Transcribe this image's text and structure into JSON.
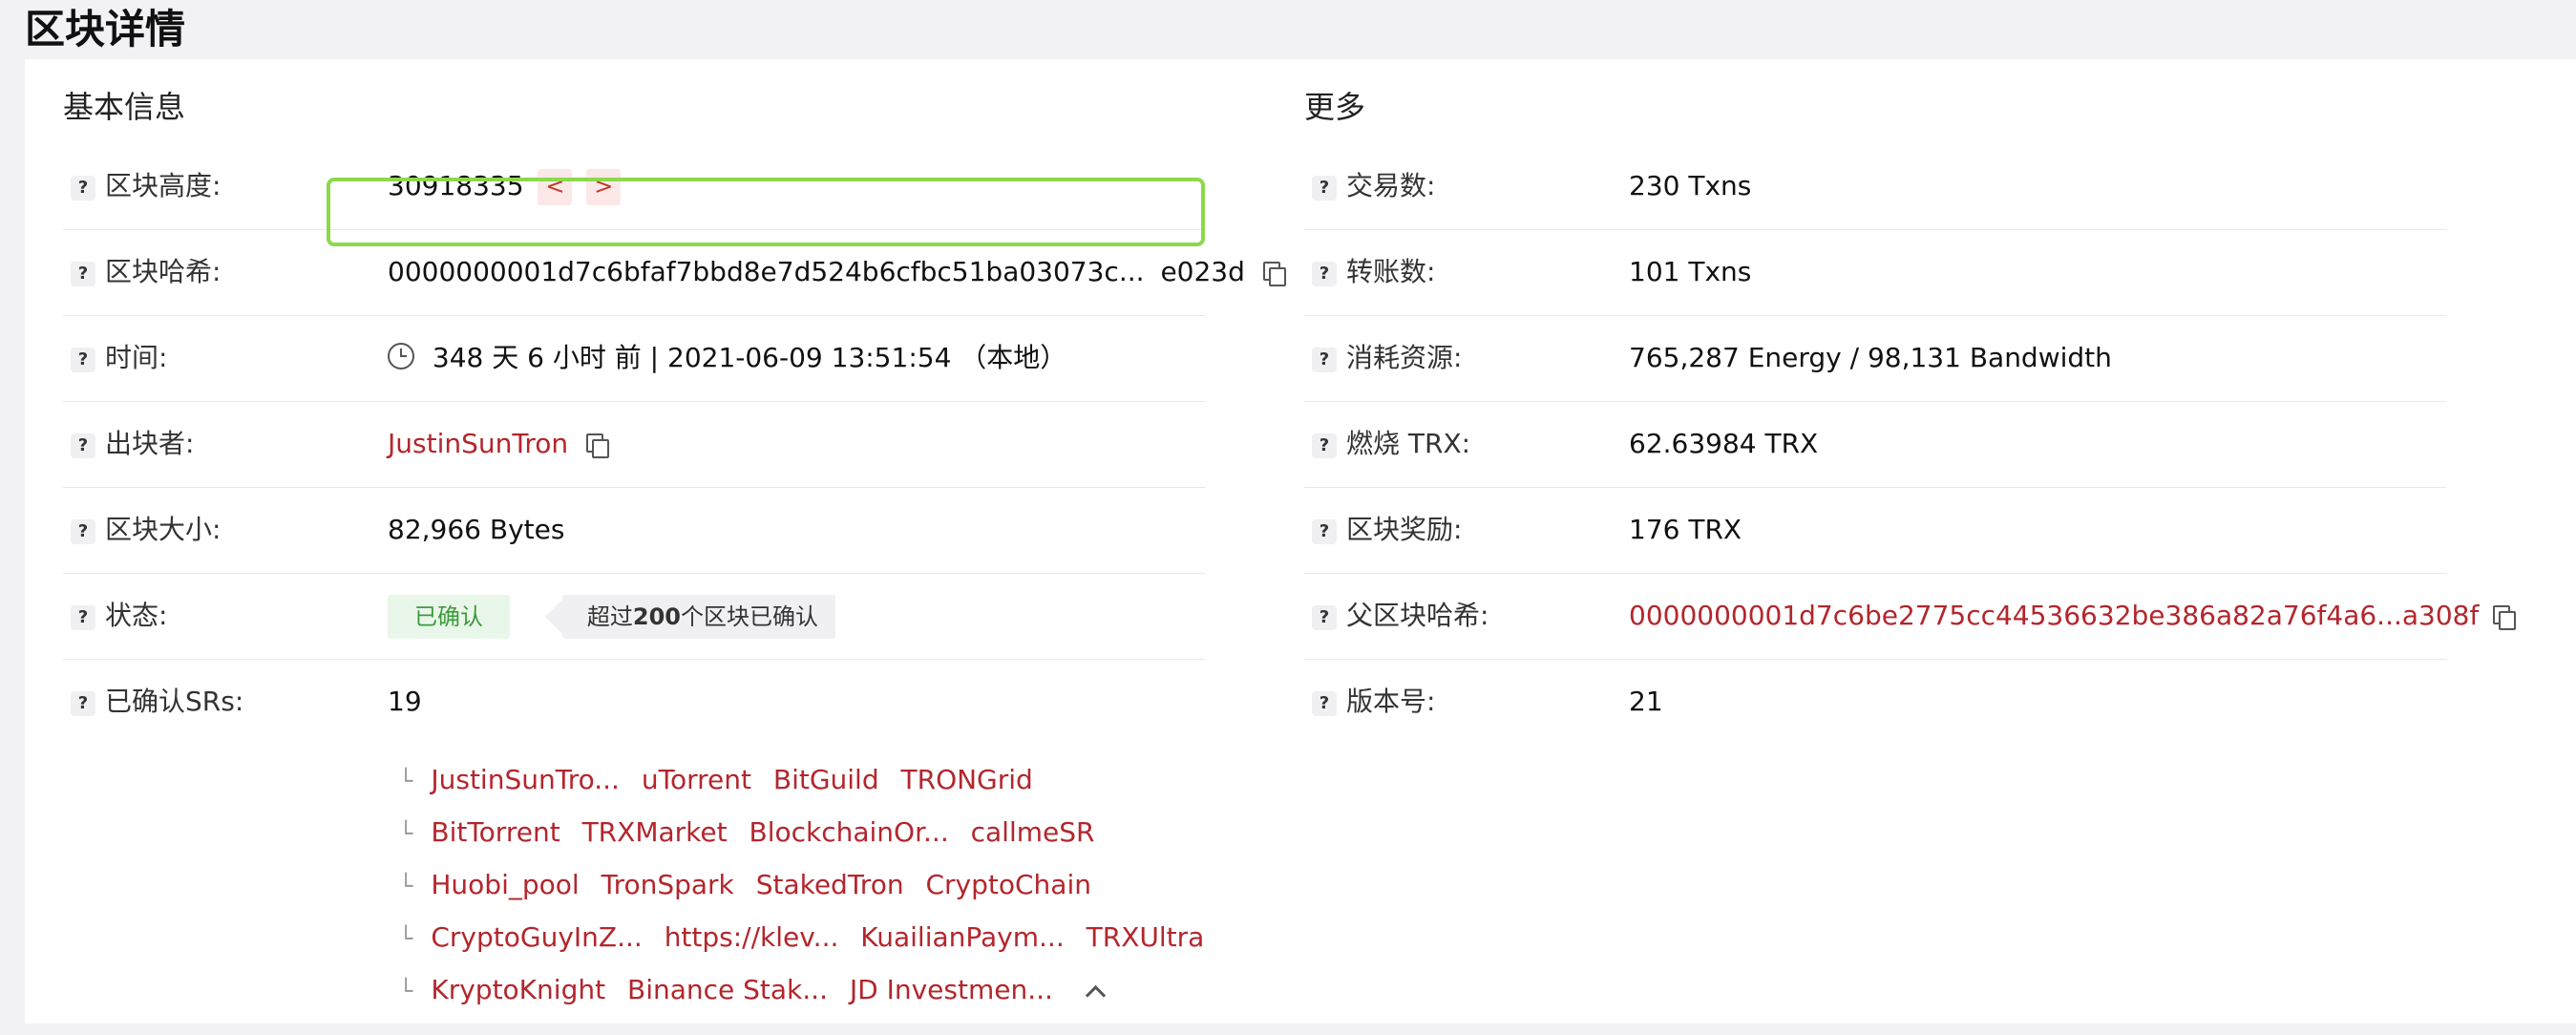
{
  "page_title": "区块详情",
  "basic": {
    "title": "基本信息",
    "height": {
      "label": "区块高度:",
      "value": "30918335",
      "prev": "<",
      "next": ">"
    },
    "hash": {
      "label": "区块哈希:",
      "value": "0000000001d7c6bfaf7bbd8e7d524b6cfbc51ba03073c...",
      "tail": "e023d"
    },
    "time": {
      "label": "时间:",
      "value": "348 天 6 小时 前 | 2021-06-09 13:51:54 （本地）"
    },
    "producer": {
      "label": "出块者:",
      "value": "JustinSunTron"
    },
    "size": {
      "label": "区块大小:",
      "value": "82,966 Bytes"
    },
    "status": {
      "label": "状态:",
      "badge": "已确认",
      "tip_pre": "超过",
      "tip_num": "200",
      "tip_post": "个区块已确认"
    },
    "confirmed_srs": {
      "label": "已确认SRs:",
      "value": "19"
    }
  },
  "sr_lines": [
    [
      "JustinSunTro...",
      "uTorrent",
      "BitGuild",
      "TRONGrid"
    ],
    [
      "BitTorrent",
      "TRXMarket",
      "BlockchainOr...",
      "callmeSR"
    ],
    [
      "Huobi_pool",
      "TronSpark",
      "StakedTron",
      "CryptoChain"
    ],
    [
      "CryptoGuyInZ...",
      "https://klev...",
      "KuailianPaym...",
      "TRXUltra"
    ],
    [
      "KryptoKnight",
      "Binance Stak...",
      "JD Investmen..."
    ]
  ],
  "more": {
    "title": "更多",
    "txns": {
      "label": "交易数:",
      "value": "230 Txns"
    },
    "transfers": {
      "label": "转账数:",
      "value": "101 Txns"
    },
    "resources": {
      "label": "消耗资源:",
      "value": "765,287 Energy / 98,131 Bandwidth"
    },
    "burn": {
      "label": "燃烧 TRX:",
      "value": "62.63984 TRX"
    },
    "reward": {
      "label": "区块奖励:",
      "value": "176 TRX"
    },
    "parent_hash": {
      "label": "父区块哈希:",
      "value": "0000000001d7c6be2775cc44536632be386a82a76f4a6...a308f"
    },
    "version": {
      "label": "版本号:",
      "value": "21"
    }
  },
  "help_glyph": "?",
  "colors": {
    "link": "#b3262d",
    "highlight": "#8cd94c",
    "confirmed": "#3c9b3c"
  }
}
